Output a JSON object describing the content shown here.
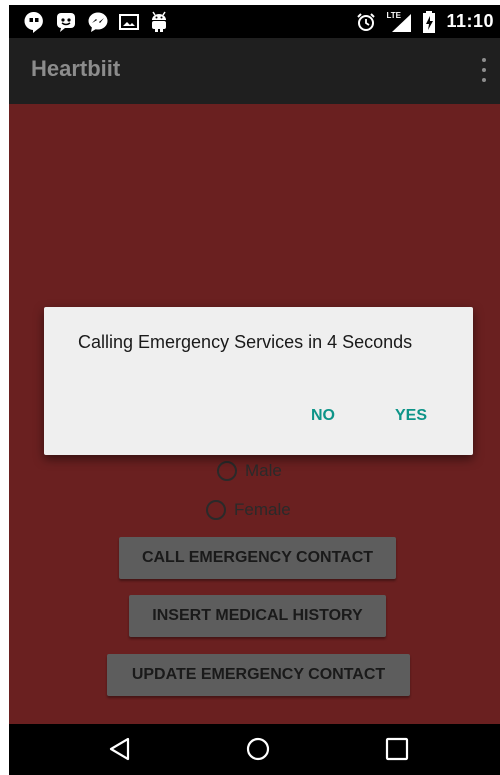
{
  "status_bar": {
    "notification_icons": [
      "hangouts-icon",
      "chat-icon",
      "messenger-icon",
      "image-icon",
      "android-icon"
    ],
    "system_icons": [
      "alarm-icon",
      "lte-signal-icon",
      "battery-charging-icon"
    ],
    "network_label": "LTE",
    "time": "11:10"
  },
  "app_bar": {
    "title": "Heartbiit",
    "overflow_icon": "more-vert-icon"
  },
  "form": {
    "gender_options": [
      "Male",
      "Female"
    ],
    "buttons": {
      "call_contact": "CALL EMERGENCY CONTACT",
      "insert_history": "INSERT MEDICAL HISTORY",
      "update_contact": "UPDATE EMERGENCY CONTACT"
    }
  },
  "dialog": {
    "message": "Calling Emergency Services in 4 Seconds",
    "negative": "NO",
    "positive": "YES"
  },
  "nav_bar": {
    "icons": [
      "back-icon",
      "home-icon",
      "recents-icon"
    ]
  },
  "colors": {
    "background": "#6a2020",
    "accent": "#0d9488",
    "button": "#5d5d5d",
    "dialog": "#efefef"
  }
}
